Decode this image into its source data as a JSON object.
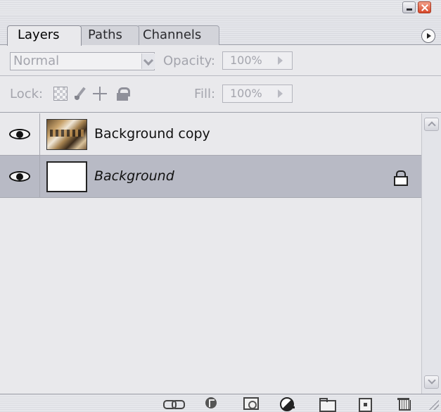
{
  "window": {
    "minimize_icon": "minimize-icon",
    "close_icon": "close-icon"
  },
  "tabs": [
    {
      "label": "Layers",
      "active": true
    },
    {
      "label": "Paths",
      "active": false
    },
    {
      "label": "Channels",
      "active": false
    }
  ],
  "options": {
    "blend_mode": "Normal",
    "opacity_label": "Opacity:",
    "opacity_value": "100%",
    "lock_label": "Lock:",
    "fill_label": "Fill:",
    "fill_value": "100%"
  },
  "layers": [
    {
      "name": "Background copy",
      "visible": true,
      "selected": false,
      "locked": false,
      "thumbnail": "photo"
    },
    {
      "name": "Background",
      "visible": true,
      "selected": true,
      "locked": true,
      "thumbnail": "white"
    }
  ],
  "toolbar_icons": [
    "link-icon",
    "layer-style-icon",
    "layer-mask-icon",
    "adjustment-layer-icon",
    "group-folder-icon",
    "new-layer-icon",
    "trash-icon"
  ],
  "colors": {
    "panel_bg": "#e9e9ec",
    "selected_row": "#b8bac5",
    "disabled_text": "#a4a5ad"
  }
}
